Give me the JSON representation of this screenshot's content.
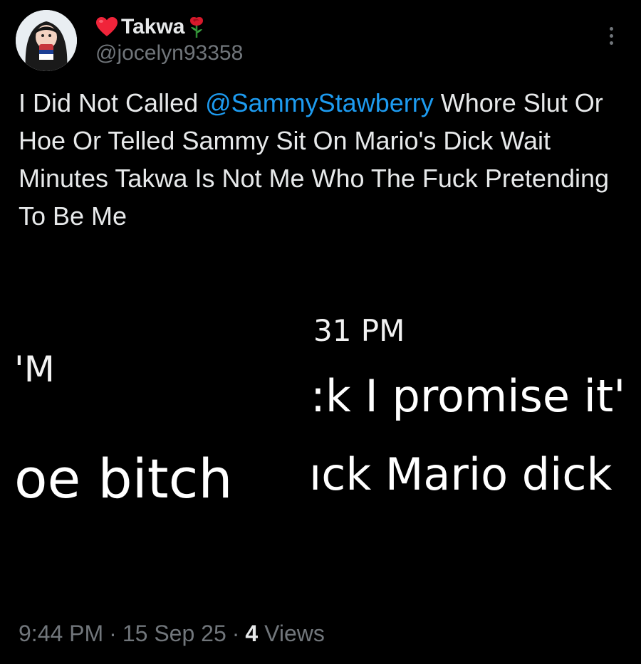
{
  "post": {
    "author": {
      "display_name": "Takwa",
      "handle": "@jocelyn93358",
      "name_prefix_icon": "red-heart-icon",
      "name_suffix_icon": "rose-icon"
    },
    "text_before_mention": "I Did Not Called ",
    "mention": "@SammyStawberry",
    "text_after_mention": "  Whore Slut Or Hoe Or Telled Sammy Sit On Mario's Dick  Wait Minutes Takwa Is Not Me Who The Fuck Pretending To  Be Me",
    "media": {
      "time_fragment": "31 PM",
      "pm_fragment": "'M",
      "promise_fragment": ":k I promise it'",
      "bitch_fragment": "oe bitch",
      "mario_fragment": "ıck Mario dick"
    },
    "meta": {
      "time": "9:44 PM",
      "separator": "·",
      "date": "15 Sep 25",
      "views_count": "4",
      "views_label": "Views"
    }
  },
  "colors": {
    "background": "#000000",
    "primary_text": "#e7e9ea",
    "secondary_text": "#71767b",
    "link": "#1d9bf0"
  }
}
